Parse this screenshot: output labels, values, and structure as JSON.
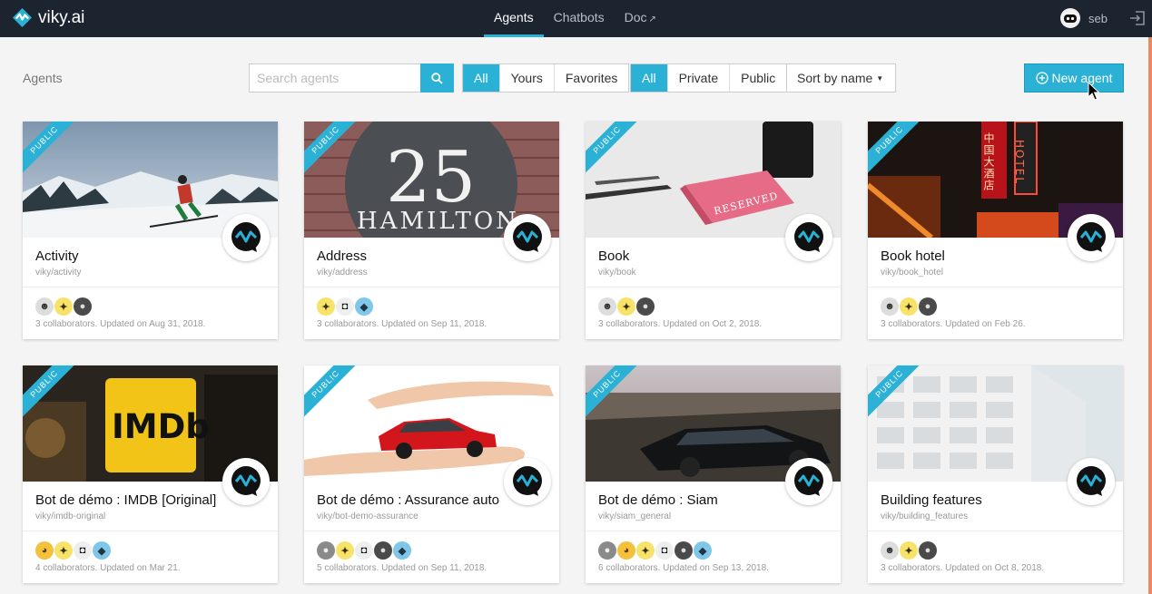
{
  "app": {
    "name": "viky.ai"
  },
  "nav": {
    "items": [
      "Agents",
      "Chatbots",
      "Doc"
    ]
  },
  "user": {
    "name": "seb"
  },
  "toolbar": {
    "page_label": "Agents",
    "search_placeholder": "Search agents",
    "filter_owner": [
      "All",
      "Yours",
      "Favorites"
    ],
    "filter_visibility": [
      "All",
      "Private",
      "Public"
    ],
    "sort_label": "Sort by name",
    "new_agent_label": "New agent"
  },
  "colors": {
    "accent": "#2bb1d6",
    "topbar": "#1c2430"
  },
  "cards": [
    {
      "ribbon": "PUBLIC",
      "title": "Activity",
      "slug": "viky/activity",
      "meta": "3 collaborators. Updated on Aug 31, 2018.",
      "image": "skier-on-snowy-mountain",
      "collaborators": [
        "person-avatar",
        "bee-avatar",
        "photo-avatar"
      ]
    },
    {
      "ribbon": "PUBLIC",
      "title": "Address",
      "slug": "viky/address",
      "meta": "3 collaborators. Updated on Sep 11, 2018.",
      "image": "house-number-25-hamilton",
      "image_text": [
        "25",
        "HAMILTON"
      ],
      "collaborators": [
        "bee-avatar",
        "robot-avatar",
        "bird-avatar"
      ]
    },
    {
      "ribbon": "PUBLIC",
      "title": "Book",
      "slug": "viky/book",
      "meta": "3 collaborators. Updated on Oct 2, 2018.",
      "image": "reserved-table-sign",
      "image_text": [
        "RESERVED"
      ],
      "collaborators": [
        "person-avatar",
        "bee-avatar",
        "photo-avatar"
      ]
    },
    {
      "ribbon": "PUBLIC",
      "title": "Book hotel",
      "slug": "viky/book_hotel",
      "meta": "3 collaborators. Updated on Feb 26.",
      "image": "neon-hotel-signs",
      "image_text": [
        "HOTEL",
        "中国大酒店"
      ],
      "collaborators": [
        "person-avatar",
        "bee-avatar",
        "photo-avatar"
      ]
    },
    {
      "ribbon": "PUBLIC",
      "title": "Bot de démo : IMDB [Original]",
      "slug": "viky/imdb-original",
      "meta": "4 collaborators. Updated on Mar 21.",
      "image": "imdb-logo-on-cinema-wall",
      "image_text": [
        "IMDb"
      ],
      "collaborators": [
        "cat-avatar",
        "bee-avatar",
        "robot-avatar",
        "bird-avatar"
      ]
    },
    {
      "ribbon": "PUBLIC",
      "title": "Bot de démo : Assurance auto",
      "slug": "viky/bot-demo-assurance",
      "meta": "5 collaborators. Updated on Sep 11, 2018.",
      "image": "red-car-in-hands",
      "collaborators": [
        "photo-avatar",
        "bee-avatar",
        "robot-avatar",
        "photo-avatar",
        "bird-avatar"
      ]
    },
    {
      "ribbon": "PUBLIC",
      "title": "Bot de démo : Siam",
      "slug": "viky/siam_general",
      "meta": "6 collaborators. Updated on Sep 13, 2018.",
      "image": "black-sedan-city-view",
      "collaborators": [
        "photo-avatar",
        "cat-avatar",
        "bee-avatar",
        "robot-avatar",
        "photo-avatar",
        "bird-avatar"
      ]
    },
    {
      "ribbon": "PUBLIC",
      "title": "Building features",
      "slug": "viky/building_features",
      "meta": "3 collaborators. Updated on Oct 8, 2018.",
      "image": "white-modern-building",
      "collaborators": [
        "person-avatar",
        "bee-avatar",
        "photo-avatar"
      ]
    }
  ]
}
